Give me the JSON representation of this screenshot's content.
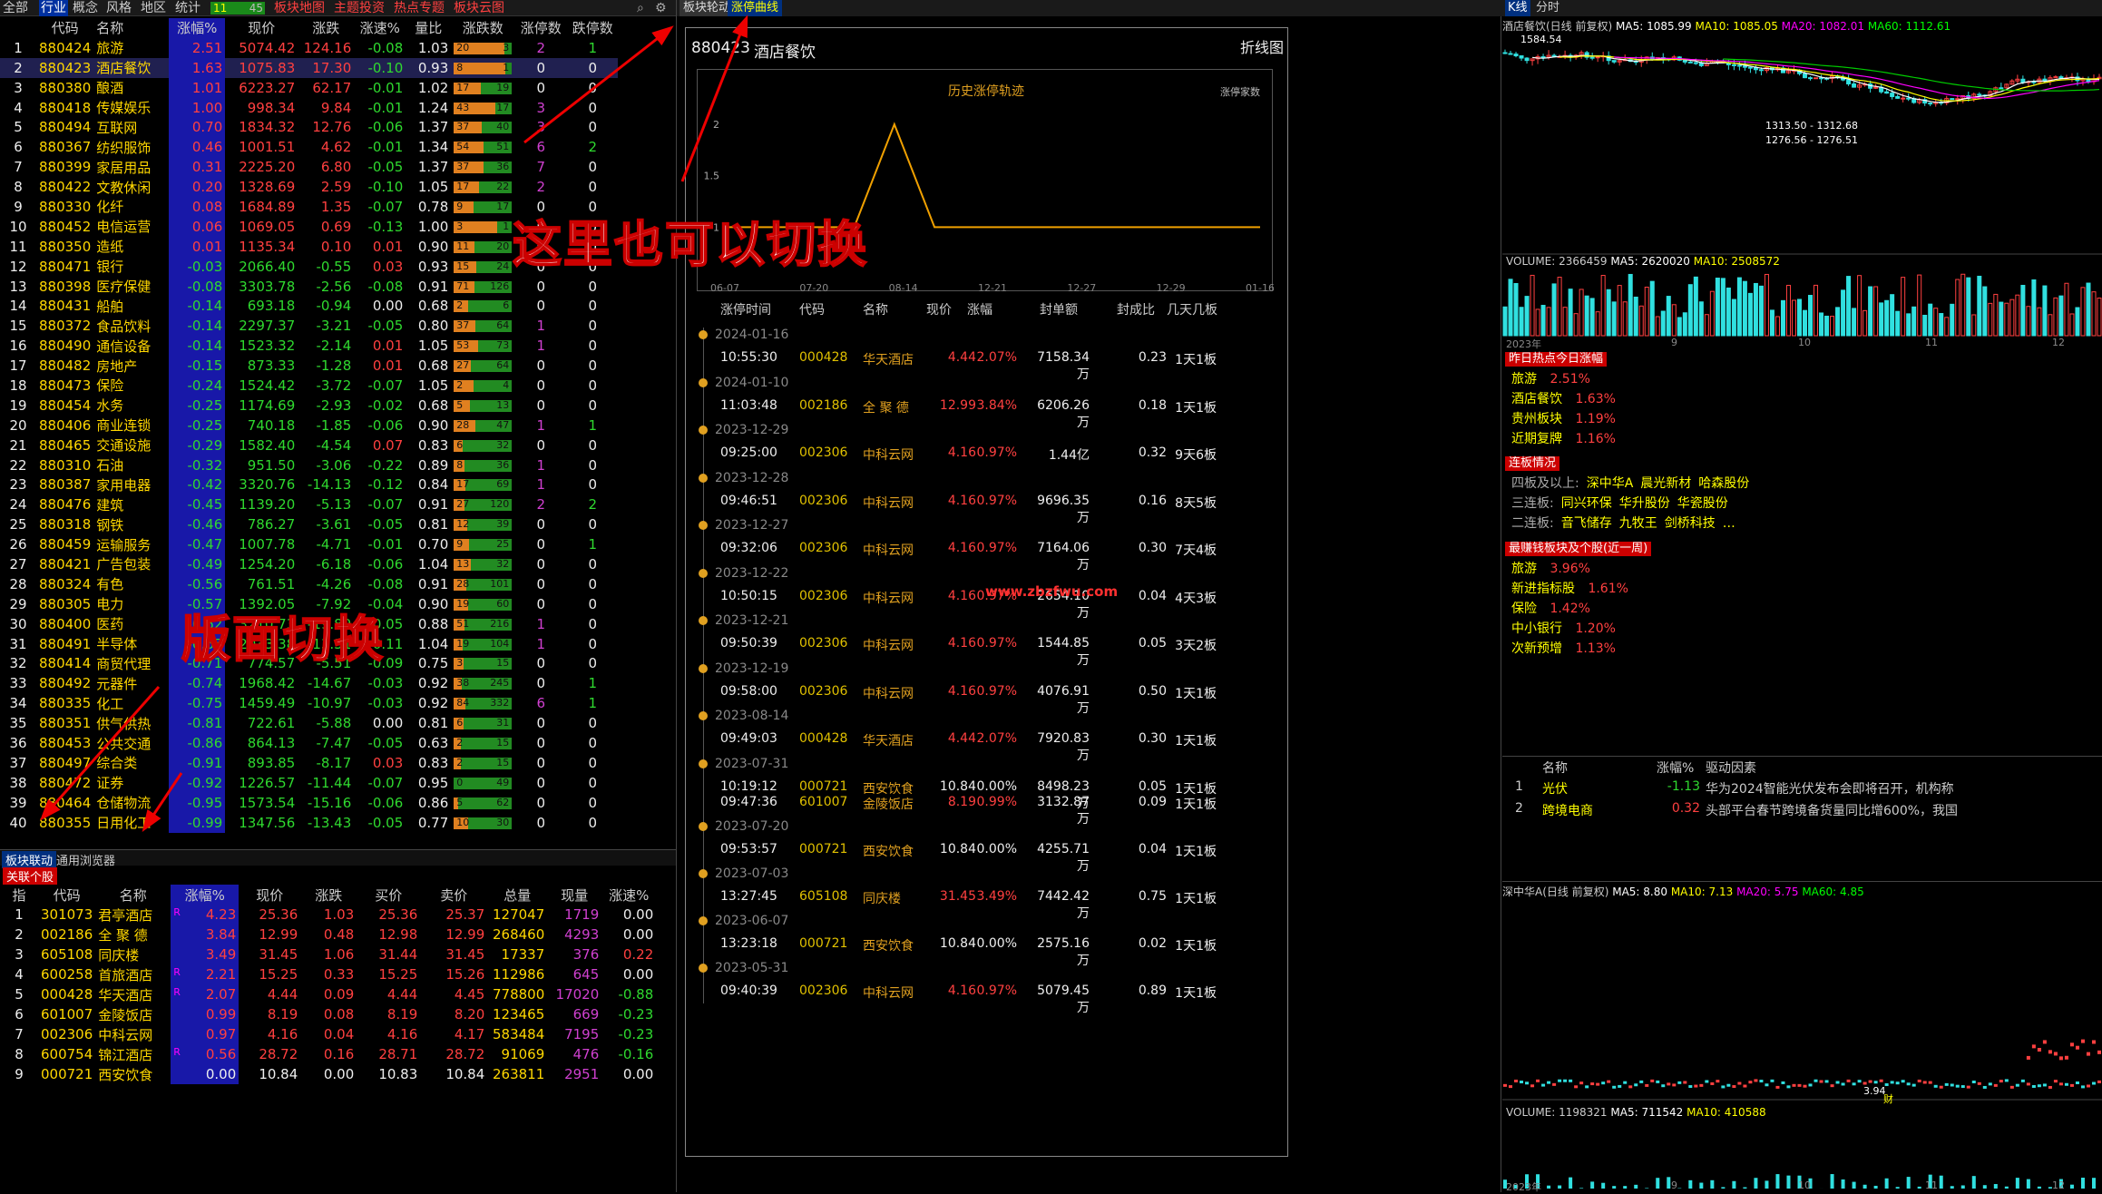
{
  "topbar": {
    "tabs": [
      "全部",
      "行业",
      "概念",
      "风格",
      "地区",
      "统计"
    ],
    "counter_left": "11",
    "counter_right": "45",
    "links": [
      "板块地图",
      "主题投资",
      "热点专题",
      "板块云图"
    ],
    "center_tabs": [
      "板块轮动",
      "涨停曲线"
    ],
    "right_tabs": [
      "K线",
      "分时"
    ]
  },
  "industry": {
    "headers": [
      "代码",
      "名称",
      "涨幅%",
      "现价",
      "涨跌",
      "涨速%",
      "量比",
      "涨跌数",
      "涨停数",
      "跌停数"
    ],
    "rows": [
      [
        "1",
        "880424",
        "旅游",
        "2.51",
        "5074.42",
        "124.16",
        "-0.08",
        "1.03",
        "20",
        "3",
        "2",
        "1"
      ],
      [
        "2",
        "880423",
        "酒店餐饮",
        "1.63",
        "1075.83",
        "17.30",
        "-0.10",
        "0.93",
        "8",
        "1",
        "0",
        "0"
      ],
      [
        "3",
        "880380",
        "酿酒",
        "1.01",
        "6223.27",
        "62.17",
        "-0.01",
        "1.02",
        "17",
        "19",
        "0",
        "0"
      ],
      [
        "4",
        "880418",
        "传媒娱乐",
        "1.00",
        "998.34",
        "9.84",
        "-0.01",
        "1.24",
        "43",
        "17",
        "3",
        "0"
      ],
      [
        "5",
        "880494",
        "互联网",
        "0.70",
        "1834.32",
        "12.76",
        "-0.06",
        "1.37",
        "37",
        "40",
        "3",
        "0"
      ],
      [
        "6",
        "880367",
        "纺织服饰",
        "0.46",
        "1001.51",
        "4.62",
        "-0.01",
        "1.34",
        "54",
        "51",
        "6",
        "2"
      ],
      [
        "7",
        "880399",
        "家居用品",
        "0.31",
        "2225.20",
        "6.80",
        "-0.05",
        "1.37",
        "37",
        "36",
        "7",
        "0"
      ],
      [
        "8",
        "880422",
        "文教休闲",
        "0.20",
        "1328.69",
        "2.59",
        "-0.10",
        "1.05",
        "17",
        "22",
        "2",
        "0"
      ],
      [
        "9",
        "880330",
        "化纤",
        "0.08",
        "1684.89",
        "1.35",
        "-0.07",
        "0.78",
        "9",
        "17",
        "0",
        "0"
      ],
      [
        "10",
        "880452",
        "电信运营",
        "0.06",
        "1069.05",
        "0.69",
        "-0.13",
        "1.00",
        "3",
        "1",
        "0",
        "0"
      ],
      [
        "11",
        "880350",
        "造纸",
        "0.01",
        "1135.34",
        "0.10",
        "0.01",
        "0.90",
        "11",
        "20",
        "0",
        "0"
      ],
      [
        "12",
        "880471",
        "银行",
        "-0.03",
        "2066.40",
        "-0.55",
        "0.03",
        "0.93",
        "15",
        "24",
        "0",
        "0"
      ],
      [
        "13",
        "880398",
        "医疗保健",
        "-0.08",
        "3303.78",
        "-2.56",
        "-0.08",
        "0.91",
        "71",
        "126",
        "0",
        "0"
      ],
      [
        "14",
        "880431",
        "船舶",
        "-0.14",
        "693.18",
        "-0.94",
        "0.00",
        "0.68",
        "2",
        "6",
        "0",
        "0"
      ],
      [
        "15",
        "880372",
        "食品饮料",
        "-0.14",
        "2297.37",
        "-3.21",
        "-0.05",
        "0.80",
        "37",
        "64",
        "1",
        "0"
      ],
      [
        "16",
        "880490",
        "通信设备",
        "-0.14",
        "1523.32",
        "-2.14",
        "0.01",
        "1.05",
        "53",
        "73",
        "1",
        "0"
      ],
      [
        "17",
        "880482",
        "房地产",
        "-0.15",
        "873.33",
        "-1.28",
        "0.01",
        "0.68",
        "27",
        "64",
        "0",
        "0"
      ],
      [
        "18",
        "880473",
        "保险",
        "-0.24",
        "1524.42",
        "-3.72",
        "-0.07",
        "1.05",
        "2",
        "4",
        "0",
        "0"
      ],
      [
        "19",
        "880454",
        "水务",
        "-0.25",
        "1174.69",
        "-2.93",
        "-0.02",
        "0.68",
        "5",
        "13",
        "0",
        "0"
      ],
      [
        "20",
        "880406",
        "商业连锁",
        "-0.25",
        "740.18",
        "-1.85",
        "-0.06",
        "0.90",
        "28",
        "47",
        "1",
        "1"
      ],
      [
        "21",
        "880465",
        "交通设施",
        "-0.29",
        "1582.40",
        "-4.54",
        "0.07",
        "0.83",
        "6",
        "32",
        "0",
        "0"
      ],
      [
        "22",
        "880310",
        "石油",
        "-0.32",
        "951.50",
        "-3.06",
        "-0.22",
        "0.89",
        "8",
        "36",
        "1",
        "0"
      ],
      [
        "23",
        "880387",
        "家用电器",
        "-0.42",
        "3320.76",
        "-14.13",
        "-0.12",
        "0.84",
        "17",
        "69",
        "1",
        "0"
      ],
      [
        "24",
        "880476",
        "建筑",
        "-0.45",
        "1139.20",
        "-5.13",
        "-0.07",
        "0.91",
        "27",
        "120",
        "2",
        "2"
      ],
      [
        "25",
        "880318",
        "钢铁",
        "-0.46",
        "786.27",
        "-3.61",
        "-0.05",
        "0.81",
        "12",
        "39",
        "0",
        "0"
      ],
      [
        "26",
        "880459",
        "运输服务",
        "-0.47",
        "1007.78",
        "-4.71",
        "-0.01",
        "0.70",
        "9",
        "25",
        "0",
        "1"
      ],
      [
        "27",
        "880421",
        "广告包装",
        "-0.49",
        "1254.20",
        "-6.18",
        "-0.06",
        "1.04",
        "13",
        "32",
        "0",
        "0"
      ],
      [
        "28",
        "880324",
        "有色",
        "-0.56",
        "761.51",
        "-4.26",
        "-0.08",
        "0.91",
        "28",
        "101",
        "0",
        "0"
      ],
      [
        "29",
        "880305",
        "电力",
        "-0.57",
        "1392.05",
        "-7.92",
        "-0.04",
        "0.90",
        "19",
        "60",
        "0",
        "0"
      ],
      [
        "30",
        "880400",
        "医药",
        "-0.62",
        "3210.73",
        "-19.89",
        "-0.05",
        "0.88",
        "51",
        "216",
        "1",
        "0"
      ],
      [
        "31",
        "880491",
        "半导体",
        "-0.65",
        "2033.38",
        "-13.31",
        "-0.11",
        "1.04",
        "19",
        "104",
        "1",
        "0"
      ],
      [
        "32",
        "880414",
        "商贸代理",
        "-0.71",
        "774.57",
        "-5.51",
        "-0.09",
        "0.75",
        "3",
        "15",
        "0",
        "0"
      ],
      [
        "33",
        "880492",
        "元器件",
        "-0.74",
        "1968.42",
        "-14.67",
        "-0.03",
        "0.92",
        "38",
        "245",
        "0",
        "1"
      ],
      [
        "34",
        "880335",
        "化工",
        "-0.75",
        "1459.49",
        "-10.97",
        "-0.03",
        "0.92",
        "84",
        "332",
        "6",
        "1"
      ],
      [
        "35",
        "880351",
        "供气供热",
        "-0.81",
        "722.61",
        "-5.88",
        "0.00",
        "0.81",
        "6",
        "31",
        "0",
        "0"
      ],
      [
        "36",
        "880453",
        "公共交通",
        "-0.86",
        "864.13",
        "-7.47",
        "-0.05",
        "0.63",
        "2",
        "15",
        "0",
        "0"
      ],
      [
        "37",
        "880497",
        "综合类",
        "-0.91",
        "893.85",
        "-8.17",
        "0.03",
        "0.83",
        "2",
        "15",
        "0",
        "0"
      ],
      [
        "38",
        "880472",
        "证券",
        "-0.92",
        "1226.57",
        "-11.44",
        "-0.07",
        "0.95",
        "0",
        "49",
        "0",
        "0"
      ],
      [
        "39",
        "880464",
        "仓储物流",
        "-0.95",
        "1573.54",
        "-15.16",
        "-0.06",
        "0.86",
        "5",
        "62",
        "0",
        "0"
      ],
      [
        "40",
        "880355",
        "日用化工",
        "-0.99",
        "1347.56",
        "-13.43",
        "-0.05",
        "0.77",
        "10",
        "30",
        "0",
        "0"
      ]
    ]
  },
  "bottom_tabs": [
    "板块联动",
    "通用浏览器"
  ],
  "related": {
    "label": "关联个股",
    "headers": [
      "指",
      "代码",
      "名称",
      "涨幅%",
      "现价",
      "涨跌",
      "买价",
      "卖价",
      "总量",
      "现量",
      "涨速%"
    ],
    "rows": [
      [
        "1",
        "301073",
        "君亭酒店",
        "R",
        "4.23",
        "25.36",
        "1.03",
        "25.36",
        "25.37",
        "127047",
        "1719",
        "0.00"
      ],
      [
        "2",
        "002186",
        "全 聚 德",
        "",
        "3.84",
        "12.99",
        "0.48",
        "12.98",
        "12.99",
        "268460",
        "4293",
        "0.00"
      ],
      [
        "3",
        "605108",
        "同庆楼",
        "",
        "3.49",
        "31.45",
        "1.06",
        "31.44",
        "31.45",
        "17337",
        "376",
        "0.22"
      ],
      [
        "4",
        "600258",
        "首旅酒店",
        "R",
        "2.21",
        "15.25",
        "0.33",
        "15.25",
        "15.26",
        "112986",
        "645",
        "0.00"
      ],
      [
        "5",
        "000428",
        "华天酒店",
        "R",
        "2.07",
        "4.44",
        "0.09",
        "4.44",
        "4.45",
        "778800",
        "17020",
        "-0.88"
      ],
      [
        "6",
        "601007",
        "金陵饭店",
        "",
        "0.99",
        "8.19",
        "0.08",
        "8.19",
        "8.20",
        "123465",
        "669",
        "-0.23"
      ],
      [
        "7",
        "002306",
        "中科云网",
        "",
        "0.97",
        "4.16",
        "0.04",
        "4.16",
        "4.17",
        "583484",
        "7195",
        "-0.23"
      ],
      [
        "8",
        "600754",
        "锦江酒店",
        "R",
        "0.56",
        "28.72",
        "0.16",
        "28.71",
        "28.72",
        "91069",
        "476",
        "-0.16"
      ],
      [
        "9",
        "000721",
        "西安饮食",
        "",
        "0.00",
        "10.84",
        "0.00",
        "10.83",
        "10.84",
        "263811",
        "2951",
        "0.00"
      ]
    ]
  },
  "center": {
    "code": "880423",
    "name": "酒店餐饮",
    "mode": "折线图",
    "chart_title": "历史涨停轨迹",
    "chart_subtitle": "涨停家数",
    "watermark": "www.zbzfwu.com",
    "table_headers": [
      "涨停时间",
      "代码",
      "名称",
      "现价",
      "涨幅",
      "封单额",
      "封成比",
      "几天几板"
    ],
    "entries": [
      {
        "date": "2024-01-16",
        "rows": [
          [
            "10:55:30",
            "000428",
            "华天酒店",
            "4.44",
            "2.07%",
            "7158.34万",
            "0.23",
            "1天1板"
          ]
        ]
      },
      {
        "date": "2024-01-10",
        "rows": [
          [
            "11:03:48",
            "002186",
            "全 聚 德",
            "12.99",
            "3.84%",
            "6206.26万",
            "0.18",
            "1天1板"
          ]
        ]
      },
      {
        "date": "2023-12-29",
        "rows": [
          [
            "09:25:00",
            "002306",
            "中科云网",
            "4.16",
            "0.97%",
            "1.44亿",
            "0.32",
            "9天6板"
          ]
        ]
      },
      {
        "date": "2023-12-28",
        "rows": [
          [
            "09:46:51",
            "002306",
            "中科云网",
            "4.16",
            "0.97%",
            "9696.35万",
            "0.16",
            "8天5板"
          ]
        ]
      },
      {
        "date": "2023-12-27",
        "rows": [
          [
            "09:32:06",
            "002306",
            "中科云网",
            "4.16",
            "0.97%",
            "7164.06万",
            "0.30",
            "7天4板"
          ]
        ]
      },
      {
        "date": "2023-12-22",
        "rows": [
          [
            "10:50:15",
            "002306",
            "中科云网",
            "4.16",
            "0.97%",
            "2654.10万",
            "0.04",
            "4天3板"
          ]
        ]
      },
      {
        "date": "2023-12-21",
        "rows": [
          [
            "09:50:39",
            "002306",
            "中科云网",
            "4.16",
            "0.97%",
            "1544.85万",
            "0.05",
            "3天2板"
          ]
        ]
      },
      {
        "date": "2023-12-19",
        "rows": [
          [
            "09:58:00",
            "002306",
            "中科云网",
            "4.16",
            "0.97%",
            "4076.91万",
            "0.50",
            "1天1板"
          ]
        ]
      },
      {
        "date": "2023-08-14",
        "rows": [
          [
            "09:49:03",
            "000428",
            "华天酒店",
            "4.44",
            "2.07%",
            "7920.83万",
            "0.30",
            "1天1板"
          ]
        ]
      },
      {
        "date": "2023-07-31",
        "rows": [
          [
            "10:19:12",
            "000721",
            "西安饮食",
            "10.84",
            "0.00%",
            "8498.23万",
            "0.05",
            "1天1板"
          ],
          [
            "09:47:36",
            "601007",
            "金陵饭店",
            "8.19",
            "0.99%",
            "3132.87万",
            "0.09",
            "1天1板"
          ]
        ]
      },
      {
        "date": "2023-07-20",
        "rows": [
          [
            "09:53:57",
            "000721",
            "西安饮食",
            "10.84",
            "0.00%",
            "4255.71万",
            "0.04",
            "1天1板"
          ]
        ]
      },
      {
        "date": "2023-07-03",
        "rows": [
          [
            "13:27:45",
            "605108",
            "同庆楼",
            "31.45",
            "3.49%",
            "7442.42万",
            "0.75",
            "1天1板"
          ]
        ]
      },
      {
        "date": "2023-06-07",
        "rows": [
          [
            "13:23:18",
            "000721",
            "西安饮食",
            "10.84",
            "0.00%",
            "2575.16万",
            "0.02",
            "1天1板"
          ]
        ]
      },
      {
        "date": "2023-05-31",
        "rows": [
          [
            "09:40:39",
            "002306",
            "中科云网",
            "4.16",
            "0.97%",
            "5079.45万",
            "0.89",
            "1天1板"
          ]
        ]
      }
    ]
  },
  "chart_data": {
    "type": "line",
    "title": "历史涨停轨迹",
    "ylabel": "涨停家数",
    "x": [
      "06-07",
      "07-20",
      "08-14",
      "12-21",
      "12-27",
      "12-29",
      "01-16"
    ],
    "ylim": [
      0.5,
      2
    ],
    "yticks": [
      "2",
      "1.5",
      "1"
    ],
    "series": [
      {
        "values": [
          1,
          1,
          2,
          1,
          1,
          1,
          1
        ]
      }
    ]
  },
  "overlays": {
    "switch_here": "这里也可以切换",
    "layout_switch": "版面切换"
  },
  "right": {
    "kline_title": "酒店餐饮(日线 前复权)",
    "ma": [
      "MA5: 1085.99",
      "MA10: 1085.05",
      "MA20: 1082.01",
      "MA60: 1112.61"
    ],
    "price_hi": "1584.54",
    "price_lbl1": "1313.50 - 1312.68",
    "price_lbl2": "1276.56 - 1276.51",
    "vol_title": "VOLUME: 2366459",
    "vol_ma": [
      "MA5: 2620020",
      "MA10: 2508572"
    ],
    "x_labels": [
      "2023年",
      "9",
      "10",
      "11",
      "12"
    ],
    "hot_title": "昨日热点今日涨幅",
    "hot": [
      [
        "旅游",
        "2.51%"
      ],
      [
        "酒店餐饮",
        "1.63%"
      ],
      [
        "贵州板块",
        "1.19%"
      ],
      [
        "近期复牌",
        "1.16%"
      ]
    ],
    "board_title": "连板情况",
    "boards": [
      [
        "四板及以上:",
        "深中华A",
        "晨光新材",
        "哈森股份"
      ],
      [
        "三连板:",
        "同兴环保",
        "华升股份",
        "华瓷股份"
      ],
      [
        "二连板:",
        "音飞储存",
        "九牧王",
        "剑桥科技",
        "…"
      ]
    ],
    "money_title": "最赚钱板块及个股(近一周)",
    "money": [
      [
        "旅游",
        "3.96%"
      ],
      [
        "新进指标股",
        "1.61%"
      ],
      [
        "保险",
        "1.42%"
      ],
      [
        "中小银行",
        "1.20%"
      ],
      [
        "次新预增",
        "1.13%"
      ]
    ],
    "drv_headers": [
      "名称",
      "涨幅%",
      "驱动因素"
    ],
    "drv": [
      [
        "1",
        "光伏",
        "-1.13",
        "华为2024智能光伏发布会即将召开，机构称"
      ],
      [
        "2",
        "跨境电商",
        "0.32",
        "头部平台春节跨境备货量同比增600%，我国"
      ]
    ],
    "k2_title": "深中华A(日线 前复权)",
    "k2_ma": [
      "MA5: 8.80",
      "MA10: 7.13",
      "MA20: 5.75",
      "MA60: 4.85"
    ],
    "k2_low": "3.94",
    "k2_mark": "财",
    "vol2_title": "VOLUME: 1198321",
    "vol2_ma": [
      "MA5: 711542",
      "MA10: 410588"
    ],
    "x2_labels": [
      "2023年",
      "9",
      "10",
      "11",
      "12"
    ]
  }
}
